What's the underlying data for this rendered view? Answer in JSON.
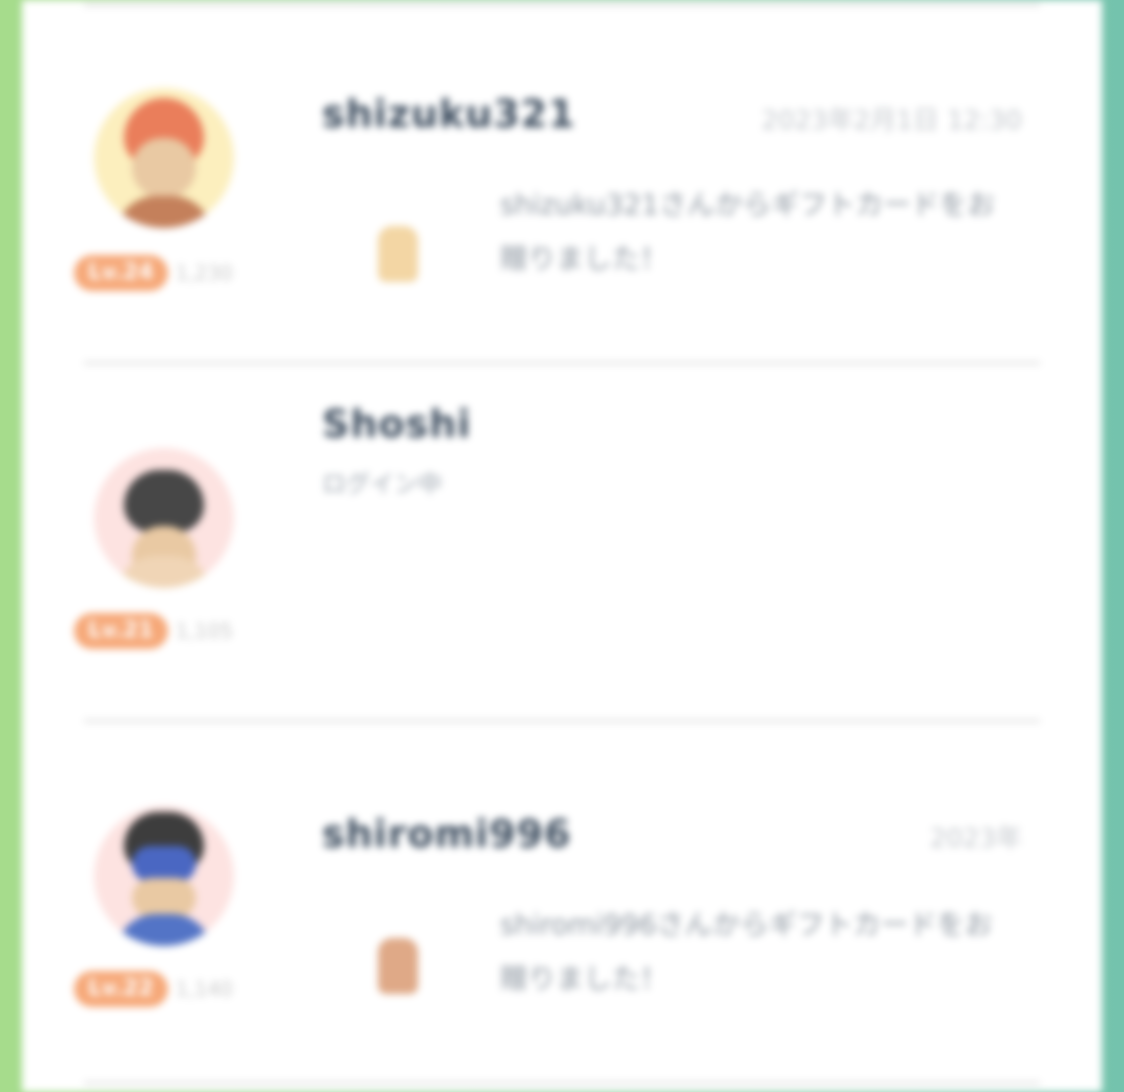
{
  "feed": {
    "items": [
      {
        "username": "shizuku321",
        "timestamp": "2023年2月1日 12:30",
        "level_label": "Lv.24",
        "points": "1,230",
        "message": "shizuku321さんからギフトカードをお贈りました！",
        "avatar_colors": {
          "bg": "#fcefbe",
          "hair": "#ea7e5b",
          "body": "#c4805b"
        },
        "gift_color": "#f3d6a4"
      },
      {
        "username": "Shoshi",
        "subtitle": "ログイン中",
        "level_label": "Lv.21",
        "points": "1,105",
        "avatar_colors": {
          "bg": "#fde3e1",
          "hair": "#474747",
          "body": "#f0d5b6"
        }
      },
      {
        "username": "shiromi996",
        "timestamp": "2023年",
        "level_label": "Lv.22",
        "points": "1,140",
        "message": "shiromi996さんからギフトカードをお贈りました！",
        "avatar_colors": {
          "bg": "#fde3e1",
          "hair": "#3d3d3d",
          "body": "#5374c6"
        },
        "gift_color": "#dfa987"
      }
    ]
  }
}
